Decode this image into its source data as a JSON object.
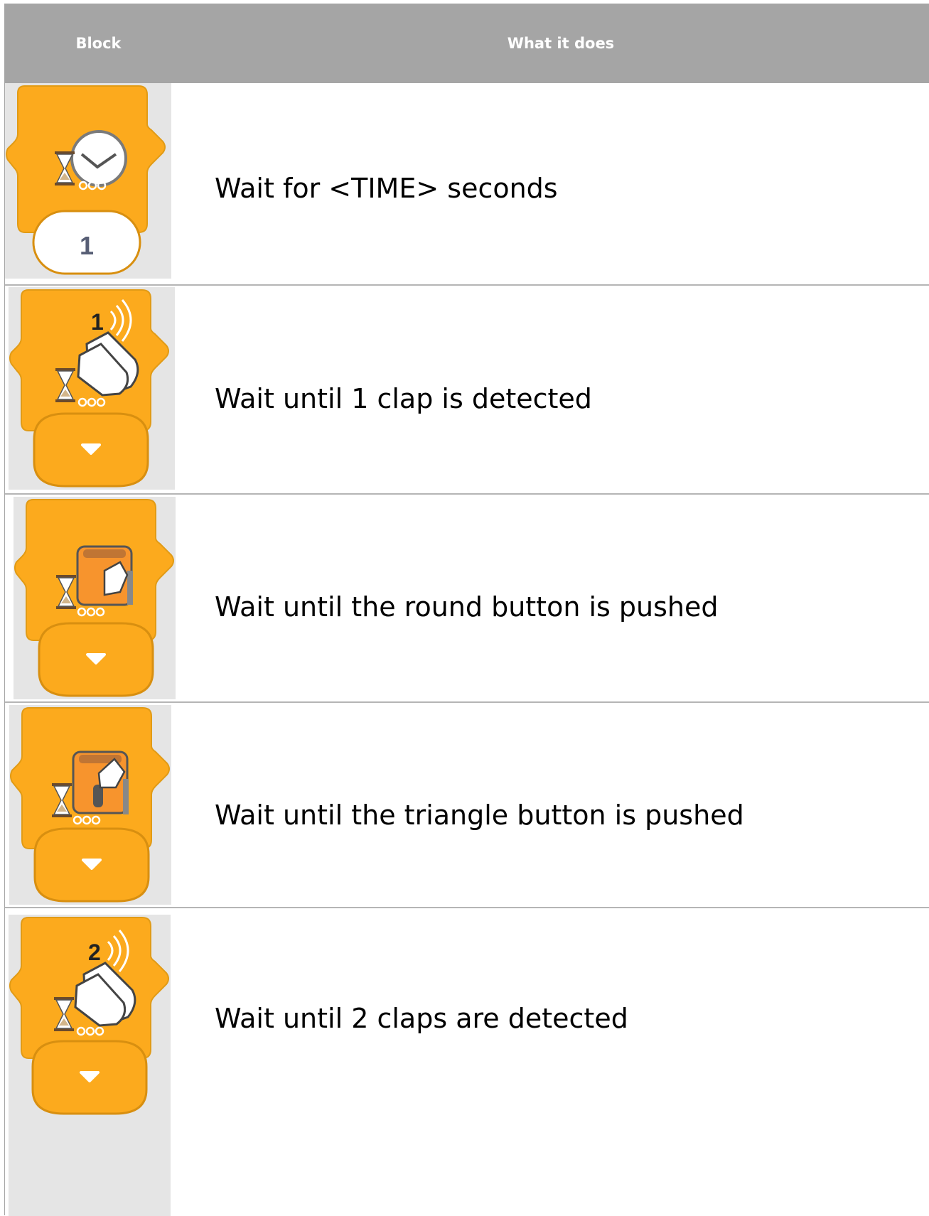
{
  "header": {
    "col_block": "Block",
    "col_what": "What it does"
  },
  "rows": [
    {
      "block_icon": "wait-time-block-icon",
      "value": "1",
      "description": "Wait for <TIME> seconds"
    },
    {
      "block_icon": "wait-clap-1-block-icon",
      "badge": "1",
      "description": "Wait until 1 clap is detected"
    },
    {
      "block_icon": "wait-round-button-block-icon",
      "description": "Wait until the round button is pushed"
    },
    {
      "block_icon": "wait-triangle-button-block-icon",
      "description": "Wait until the triangle button is pushed"
    },
    {
      "block_icon": "wait-clap-2-block-icon",
      "badge": "2",
      "description": "Wait until 2 claps are detected"
    }
  ],
  "colors": {
    "block_orange": "#fcaa1d",
    "block_border": "#d88f10",
    "header_bg": "#a5a5a5",
    "cell_bg": "#e5e5e5"
  }
}
